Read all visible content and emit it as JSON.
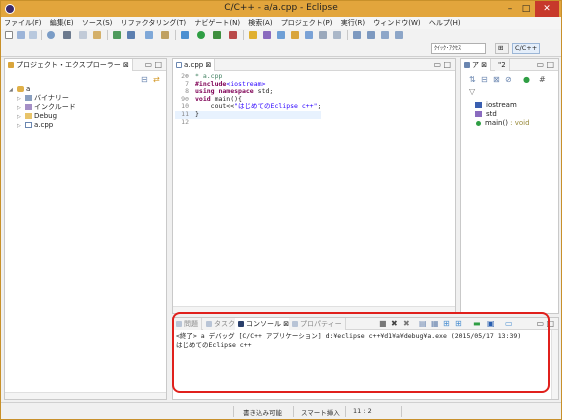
{
  "window": {
    "title": "C/C++ - a/a.cpp - Eclipse",
    "minimize": "–",
    "maximize": "□",
    "close": "✕"
  },
  "menu": [
    "ファイル(F)",
    "編集(E)",
    "ソース(S)",
    "リファクタリング(T)",
    "ナビゲート(N)",
    "検索(A)",
    "プロジェクト(P)",
    "実行(R)",
    "ウィンドウ(W)",
    "ヘルプ(H)"
  ],
  "perspective": {
    "quick_access": "ｸｲｯｸ･ｱｸｾｽ",
    "cpp_label": "C/C++"
  },
  "project_explorer": {
    "tab_label": "プロジェクト・エクスプローラー",
    "tree": {
      "root": "a",
      "children": [
        "バイナリー",
        "インクルード",
        "Debug",
        "a.cpp"
      ]
    }
  },
  "editor": {
    "tab_label": "a.cpp",
    "lines": [
      {
        "num": "2⊕",
        "text": "* a.cpp"
      },
      {
        "num": "7",
        "pp": "#include",
        "inc": "<iostream>"
      },
      {
        "num": "8",
        "kw": "using namespace",
        "rest": " std;"
      },
      {
        "num": "9⊖",
        "kw": "void",
        "rest": " main(){"
      },
      {
        "num": "10",
        "pre": "    cout<<",
        "str": "\"はじめてのEclipse c++\"",
        "post": ";"
      },
      {
        "num": "11",
        "rest": "}"
      },
      {
        "num": "12",
        "rest": ""
      }
    ]
  },
  "outline": {
    "tab_label": "ア",
    "tab2_label": "\"2",
    "items": [
      {
        "name": "iostream",
        "type": ""
      },
      {
        "name": "std",
        "type": ""
      },
      {
        "name": "main()",
        "type": " : void"
      }
    ]
  },
  "bottom_tabs": {
    "problems": "問題",
    "tasks": "タスク",
    "console": "コンソール",
    "properties": "プロパティー"
  },
  "console": {
    "header_line": "<終了> a デバッグ [C/C++ アプリケーション] d:¥eclipse c++¥d1¥a¥debug¥a.exe (2015/05/17 13:39)",
    "output_line": "はじめてのEclipse c++"
  },
  "status": {
    "writable": "書き込み可能",
    "insert_mode": "スマート挿入",
    "position": "11 : 2"
  },
  "colors": {
    "title_bar": "#e2a53c",
    "close_button": "#c7392b",
    "highlight_box": "#e0201c"
  }
}
